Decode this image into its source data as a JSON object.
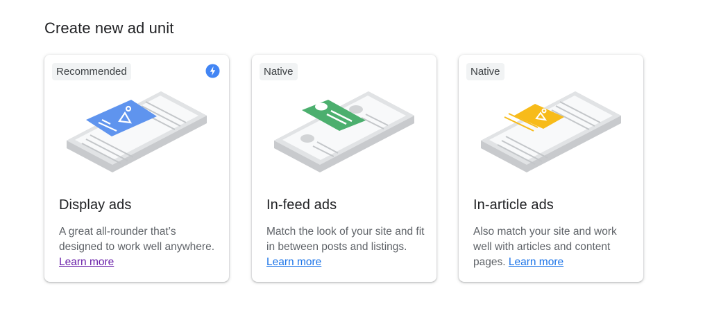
{
  "page": {
    "title": "Create new ad unit"
  },
  "colors": {
    "display_blue": "#5f94ee",
    "native_green": "#4caf6e",
    "article_yellow": "#f7bb1a",
    "badge_bolt": "#4285f4",
    "link": "#1a73e8",
    "link_visited": "#681da8"
  },
  "cards": [
    {
      "badge": "Recommended",
      "badge_icon": "bolt-icon",
      "title": "Display ads",
      "description": "A great all-rounder that’s designed to work well anywhere.",
      "link": "Learn more"
    },
    {
      "badge": "Native",
      "title": "In-feed ads",
      "description": "Match the look of your site and fit in between posts and listings.",
      "link": "Learn more"
    },
    {
      "badge": "Native",
      "title": "In-article ads",
      "description": "Also match your site and work well with articles and content pages.",
      "link": "Learn more"
    }
  ]
}
